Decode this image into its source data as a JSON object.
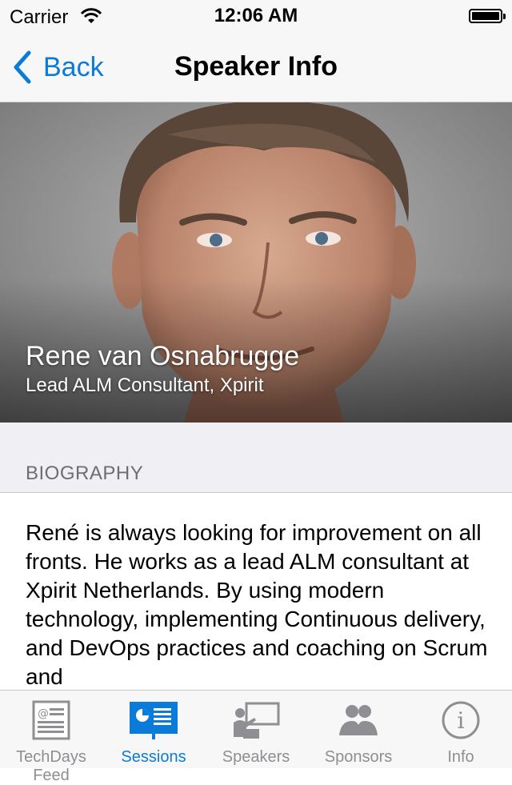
{
  "status_bar": {
    "carrier": "Carrier",
    "time": "12:06 AM"
  },
  "nav": {
    "back_label": "Back",
    "title": "Speaker Info"
  },
  "speaker": {
    "name": "Rene van Osnabrugge",
    "title": "Lead ALM Consultant, Xpirit"
  },
  "biography": {
    "header": "BIOGRAPHY",
    "text": "René is always looking for improvement on all fronts. He works as a lead ALM consultant at Xpirit Netherlands. By using modern technology, implementing Continuous delivery, and DevOps practices and coaching on Scrum and"
  },
  "tabs": [
    {
      "label": "TechDays Feed",
      "icon": "news-feed-icon",
      "active": false
    },
    {
      "label": "Sessions",
      "icon": "presentation-icon",
      "active": true
    },
    {
      "label": "Speakers",
      "icon": "speaker-podium-icon",
      "active": false
    },
    {
      "label": "Sponsors",
      "icon": "group-icon",
      "active": false
    },
    {
      "label": "Info",
      "icon": "info-icon",
      "active": false
    }
  ],
  "colors": {
    "accent": "#0a7bd9",
    "inactive": "#8e8e93",
    "bar_bg": "#f7f7f7",
    "section_bg": "#efeff4"
  }
}
